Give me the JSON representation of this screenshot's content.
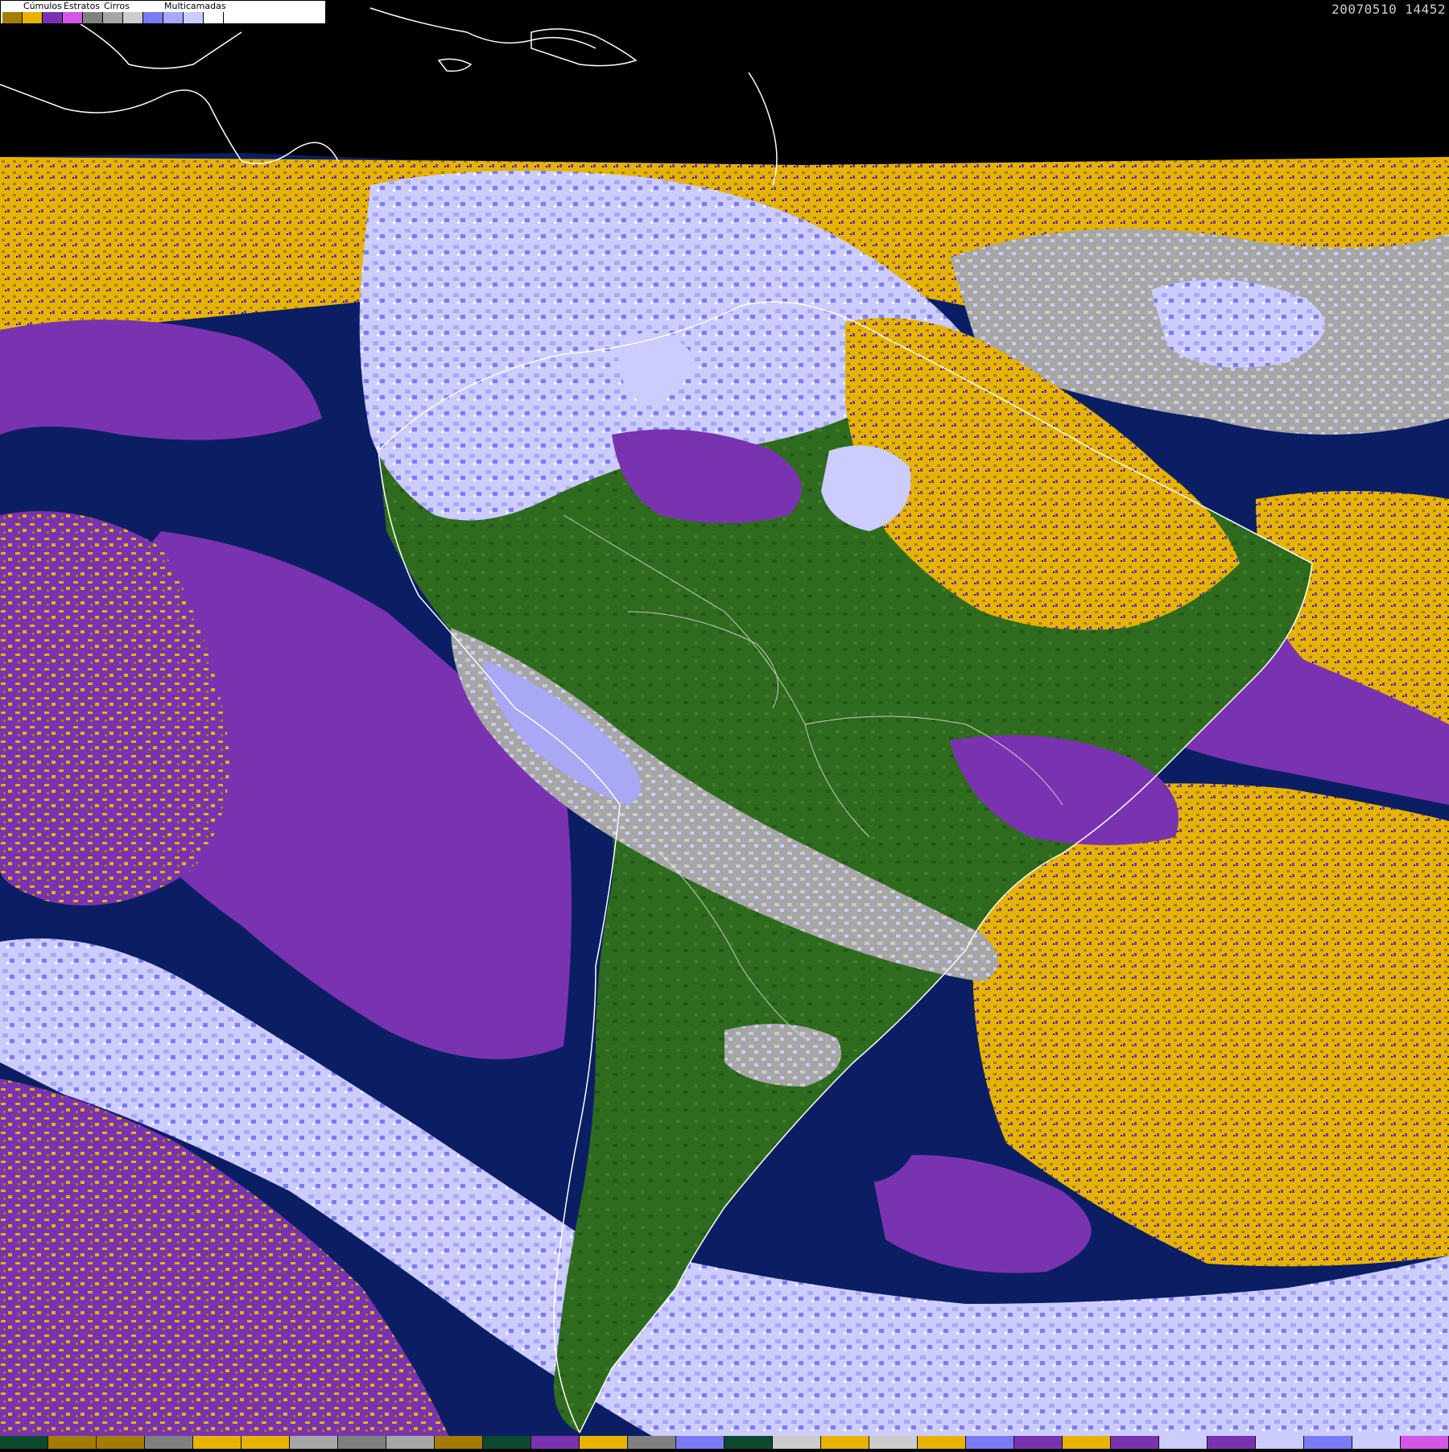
{
  "timestamp": "20070510 14452",
  "legend": {
    "groups": [
      {
        "label": "Cúmulos",
        "colors": [
          "#a67c00",
          "#e6b400"
        ]
      },
      {
        "label": "Estratos",
        "colors": [
          "#7a33b0",
          "#d455e6"
        ]
      },
      {
        "label": "Cirros",
        "colors": [
          "#808080",
          "#a6a6a6",
          "#cccccc"
        ]
      },
      {
        "label": "Multicamadas",
        "colors": [
          "#7b7bf5",
          "#a8a8f5",
          "#ccccff",
          "#ffffff"
        ]
      }
    ]
  },
  "palette": {
    "ocean": "#0b1e64",
    "land": "#2f6b1e",
    "land_light": "#4f8a2a",
    "space": "#000000",
    "cumulus_dark": "#a67c00",
    "cumulus": "#e6b400",
    "stratus": "#7a33b0",
    "stratus_light": "#d455e6",
    "cirrus": "#a6a6a6",
    "multi": "#7b7bf5",
    "multi_light": "#ccccff",
    "coast": "#ffffff"
  },
  "bottom_strip": [
    "#0b4a2e",
    "#a67c00",
    "#a67c00",
    "#808080",
    "#e6b400",
    "#e6b400",
    "#a6a6a6",
    "#808080",
    "#a6a6a6",
    "#a67c00",
    "#0b4a2e",
    "#7a33b0",
    "#e6b400",
    "#808080",
    "#7b7bf5",
    "#0b4a2e",
    "#cccccc",
    "#e6b400",
    "#cccccc",
    "#e6b400",
    "#7b7bf5",
    "#7a33b0",
    "#e6b400",
    "#7a33b0",
    "#ccccff",
    "#7a33b0",
    "#ccccff",
    "#7b7bf5",
    "#ccccff",
    "#d455e6"
  ]
}
